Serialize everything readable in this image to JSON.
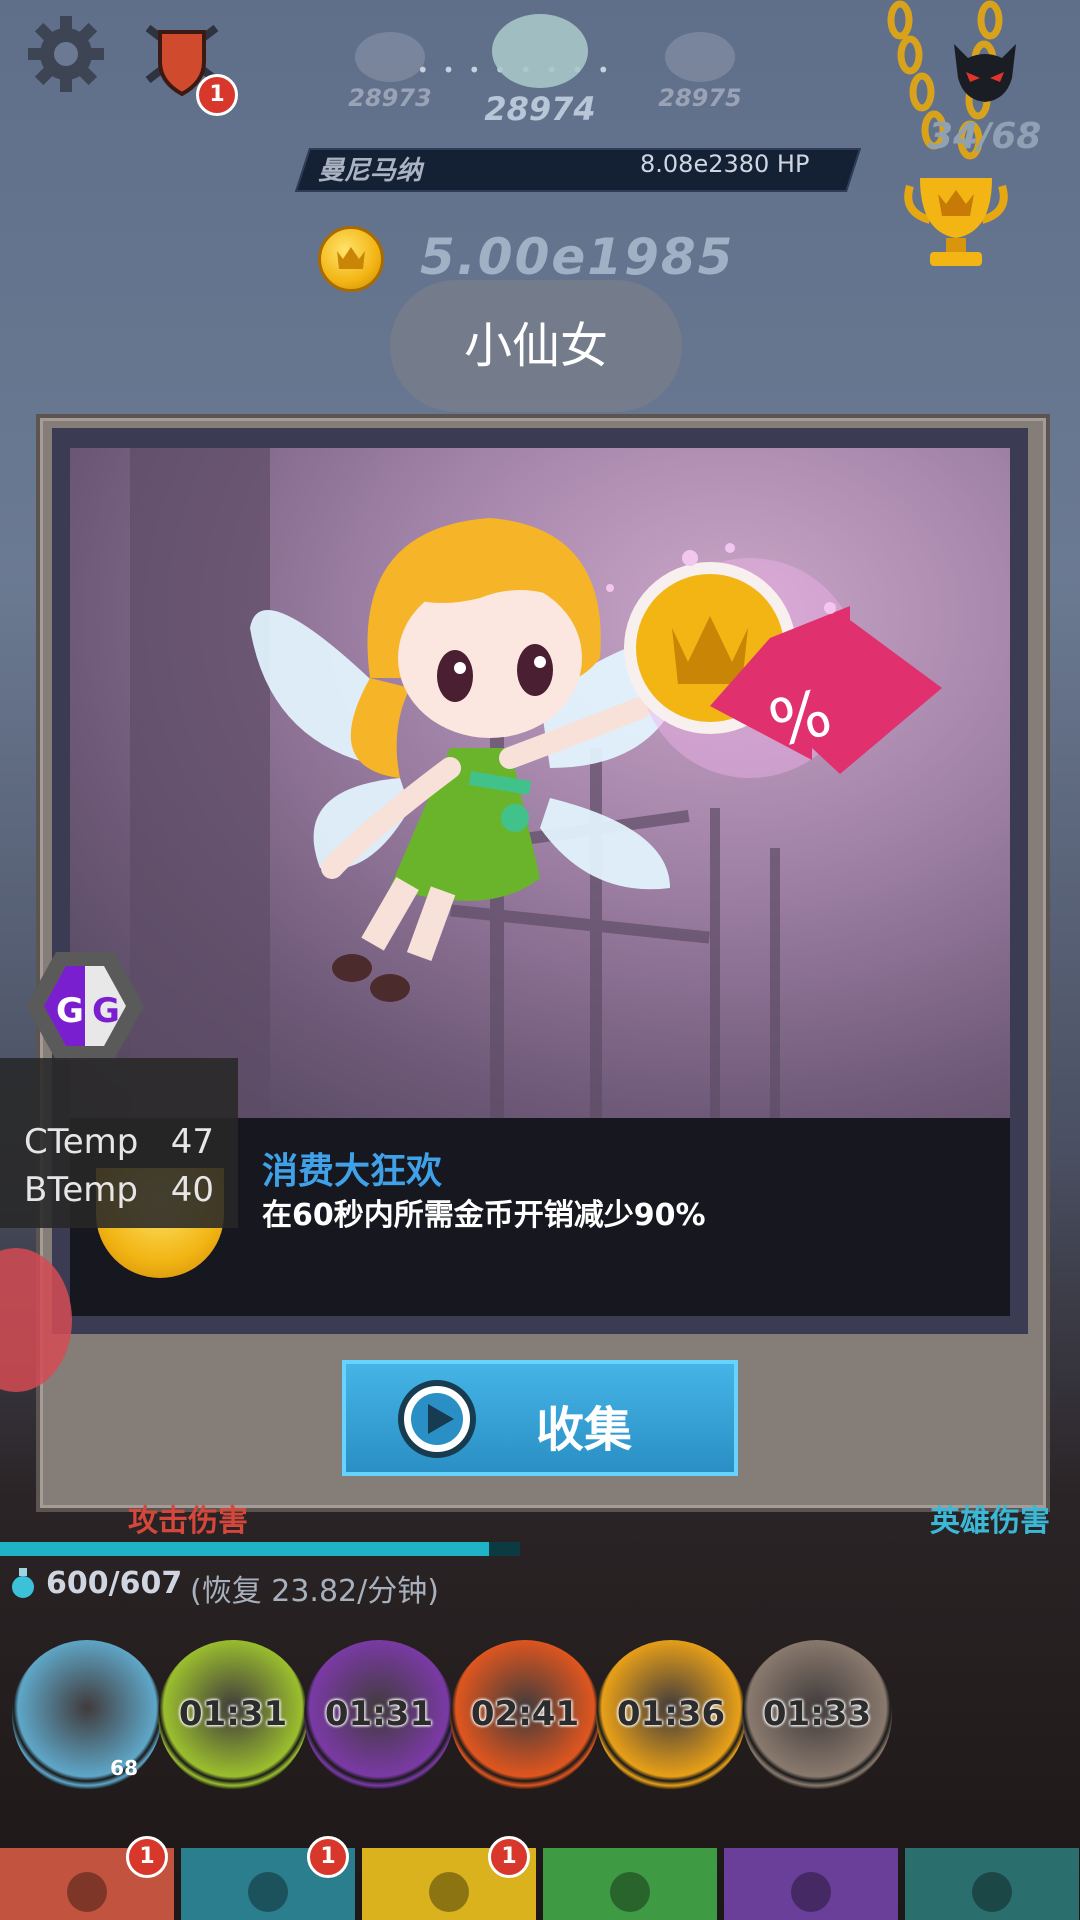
{
  "hud": {
    "settings": "gear-icon",
    "shield_badge": "1",
    "stages": {
      "prev": "28973",
      "current": "28974",
      "next": "28975"
    },
    "boss_name": "曼尼马纳",
    "boss_hp": "8.08e2380 HP",
    "gold": "5.00e1985",
    "relics": "34/68"
  },
  "modal": {
    "title": "小仙女",
    "bonus_title": "消费大狂欢",
    "bonus_desc": "在60秒内所需金币开销减少90%",
    "collect_label": "收集"
  },
  "overlay": {
    "ctemp_label": "CTemp",
    "ctemp_value": "47",
    "btemp_label": "BTemp",
    "btemp_value": "40"
  },
  "bottom": {
    "tap_damage_label": "攻击伤害",
    "hero_damage_label": "英雄伤害",
    "mana": "600/607",
    "mana_regen": "(恢复 23.82/分钟)",
    "mana_fill": 0.94,
    "skills": [
      {
        "name": "heavenly-strike",
        "timer": "",
        "level": "68",
        "color": "#5fa7c8"
      },
      {
        "name": "deadly-strike",
        "timer": "01:31",
        "color": "#9bbf2e"
      },
      {
        "name": "hand-of-midas",
        "timer": "01:31",
        "color": "#7b3aa6"
      },
      {
        "name": "fire-sword",
        "timer": "02:41",
        "color": "#e0561f"
      },
      {
        "name": "war-cry",
        "timer": "01:36",
        "color": "#e8a018"
      },
      {
        "name": "shadow-clone",
        "timer": "01:33",
        "color": "#8a7a6e"
      }
    ],
    "tabs": [
      {
        "name": "sword",
        "badge": "1",
        "color": "#c2533f"
      },
      {
        "name": "heroes",
        "badge": "1",
        "color": "#2a7e8e"
      },
      {
        "name": "equipment",
        "badge": "1",
        "color": "#d9b21e"
      },
      {
        "name": "pets",
        "badge": "",
        "color": "#3f9a44"
      },
      {
        "name": "clan",
        "badge": "",
        "color": "#6a3f9a"
      },
      {
        "name": "shop",
        "badge": "",
        "color": "#2b6e6e"
      }
    ]
  }
}
